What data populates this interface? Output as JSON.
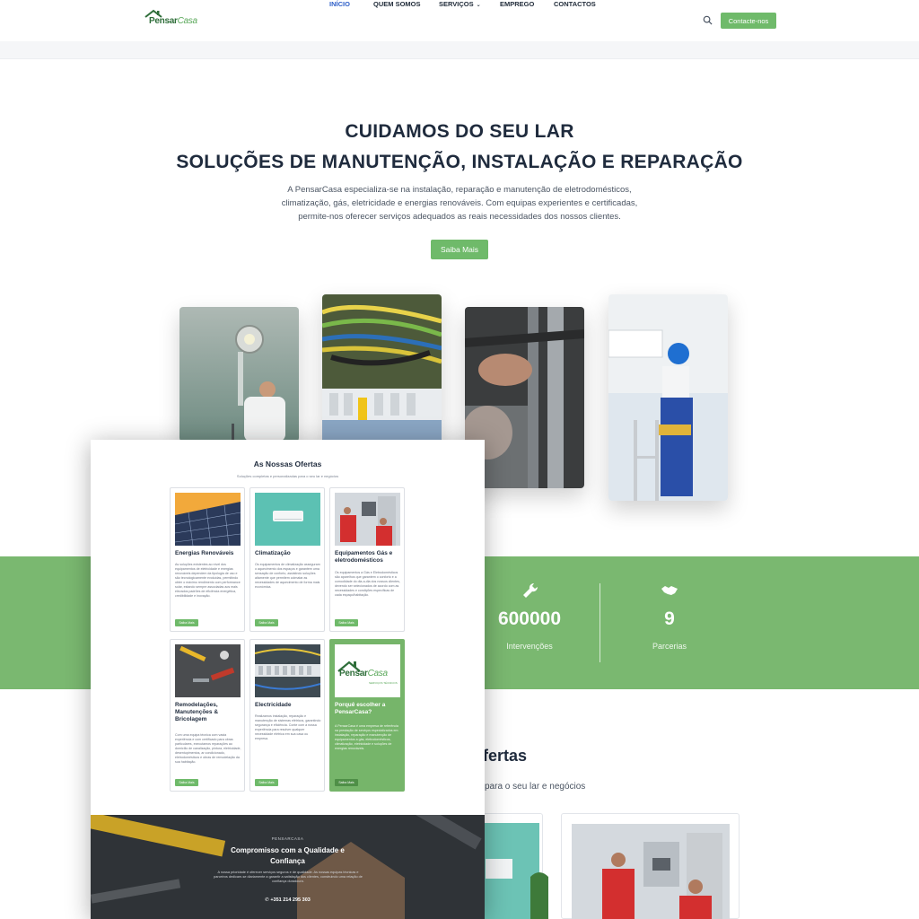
{
  "header": {
    "logo": {
      "brand_main": "Pensar",
      "brand_accent": "Casa"
    },
    "nav": [
      {
        "label": "INÍCIO",
        "active": true
      },
      {
        "label": "QUEM SOMOS",
        "active": false
      },
      {
        "label": "SERVIÇOS",
        "active": false,
        "has_dropdown": true
      },
      {
        "label": "EMPREGO",
        "active": false
      },
      {
        "label": "CONTACTOS",
        "active": false
      }
    ],
    "search_icon": "search-icon",
    "cta_label": "Contacte-nos"
  },
  "hero": {
    "title_line1": "CUIDAMOS DO SEU LAR",
    "title_line2": "SOLUÇÕES DE MANUTENÇÃO, INSTALAÇÃO E REPARAÇÃO",
    "description": "A PensarCasa especializa-se na instalação, reparação e manutenção de eletrodomésticos, climatização, gás, eletricidade e energias renováveis. Com equipas experientes e certificadas, permite-nos oferecer serviços adequados as reais necessidades dos nossos clientes.",
    "button_label": "Saiba Mais"
  },
  "stats": [
    {
      "icon": "wrench-icon",
      "value": "600000",
      "label": "Intervenções"
    },
    {
      "icon": "handshake-icon",
      "value": "9",
      "label": "Parcerias"
    }
  ],
  "offers_section": {
    "heading_partial": "fertas",
    "sub_partial": "para o seu lar e negócios"
  },
  "overlay": {
    "title": "As Nossas Ofertas",
    "subtitle": "Soluções completas e personalizadas para o seu lar e negócios",
    "cards": [
      {
        "title": "Energias Renováveis",
        "text": "As soluções existentes ao nível dos equipamentos de eletricidade e energias renováveis dependem da tipologia de uso e são tecnologicamente evoluídas, permitindo obter o máximo rendimento com performance solar, estando sempre associadas aos mais elevados padrões de eficiência energética, credibilidade e inovação.",
        "button": "Saiba Mais"
      },
      {
        "title": "Climatização",
        "text": "Os equipamentos de climatização asseguram o aquecimento dos espaços e garantem uma sensação de conforto, assistindo soluções altamente que permitem colmatar as necessidades de aquecimento de forma mais económica.",
        "button": "Saiba Mais"
      },
      {
        "title": "Equipamentos Gás e eletrodomésticos",
        "text": "Os equipamentos a Gás e Eletrodomésticos são aparelhos que garantem o conforto e a comodidade do dia-a-dia dos nossos clientes, devendo ser selecionados de acordo com as necessidades e condições específicas de cada espaço/habitação.",
        "button": "Saiba Mais"
      },
      {
        "title": "Remodelações, Manutenções & Bricolagem",
        "text": "Com uma equipa técnica com vasta experiência e com certificado para obras particulares, executamos reparações ao domicílio de canalização, pintura, eletricidade, desentupimentos, ar condicionado, eletrodomésticos e obras de remodelação da sua habitação.",
        "button": "Saiba Mais"
      },
      {
        "title": "Electricidade",
        "text": "Realizamos instalação, reparação e manutenção de sistemas elétricos, garantindo segurança e eficiência. Conte com a nossa experiência para resolver qualquer necessidade elétrica em sua casa ou empresa.",
        "button": "Saiba Mais"
      },
      {
        "title": "Porquê escolher a PensarCasa?",
        "text": "A PensarCasa é uma empresa de referência na prestação de serviços especializados em instalação, reparação e manutenção de equipamentos a gás, eletrodomésticos, climatização, eletricidade e soluções de energias renováveis.",
        "button": "Saiba Mais",
        "logo_main": "Pensar",
        "logo_accent": "Casa",
        "logo_tag": "SERVIÇOS TÉCNICOS"
      }
    ],
    "footer": {
      "kicker": "PENSARCASA",
      "title_line1": "Compromisso com a Qualidade e",
      "title_line2": "Confiança",
      "description": "A nossa prioridade é oferecer serviços seguros e de qualidade. As nossas equipas técnicas e parceiros dedicam-se diariamente a garantir a satisfação dos clientes, construindo uma relação de confiança duradoura.",
      "phone": "+351 214 295 303"
    }
  },
  "colors": {
    "accent_green": "#6fba6a",
    "band_green": "#7ab870",
    "nav_active": "#2f5fc8",
    "heading": "#1f2b3d"
  }
}
